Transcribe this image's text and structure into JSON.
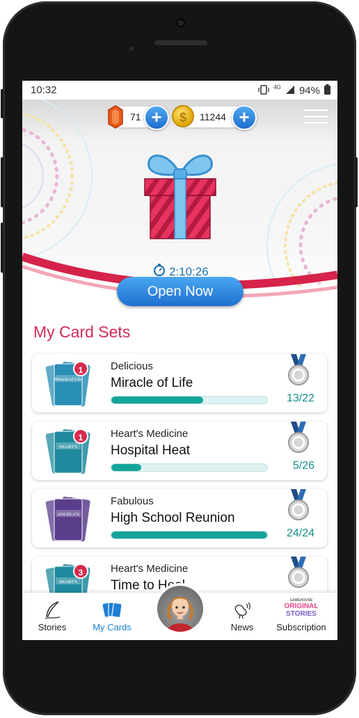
{
  "status": {
    "time": "10:32",
    "network": "4G",
    "battery": "94%"
  },
  "currency": {
    "gems": "71",
    "coins": "11244",
    "coin_symbol": "$"
  },
  "gift": {
    "timer": "2:10:26",
    "open_label": "Open Now"
  },
  "section_title": "My Card Sets",
  "cards": [
    {
      "category": "Delicious",
      "name": "Miracle of Life",
      "count": "13/22",
      "progress": 0.59,
      "badge": "1",
      "thumb_text": "Miracle of Life",
      "thumb_color": "#2a8fb5"
    },
    {
      "category": "Heart's Medicine",
      "name": "Hospital Heat",
      "count": "5/26",
      "progress": 0.19,
      "badge": "1",
      "thumb_text": "HEART'S",
      "thumb_color": "#1f8a9e"
    },
    {
      "category": "Fabulous",
      "name": "High School Reunion",
      "count": "24/24",
      "progress": 1.0,
      "badge": "",
      "thumb_text": "ANGELA'S",
      "thumb_color": "#5a3e8c"
    },
    {
      "category": "Heart's Medicine",
      "name": "Time to Heal",
      "count": "",
      "progress": 0,
      "badge": "3",
      "thumb_text": "HEART'S",
      "thumb_color": "#1f8a9e"
    }
  ],
  "tabs": {
    "stories": "Stories",
    "my_cards": "My Cards",
    "news": "News",
    "subscription": "Subscription",
    "subscription_logo_top": "GAMEHOUSE",
    "subscription_logo_mid": "ORIGINAL",
    "subscription_logo_bottom": "STORIES"
  },
  "colors": {
    "accent": "#1f7fd4",
    "brand_red": "#d12b55",
    "progress": "#15a49a"
  }
}
